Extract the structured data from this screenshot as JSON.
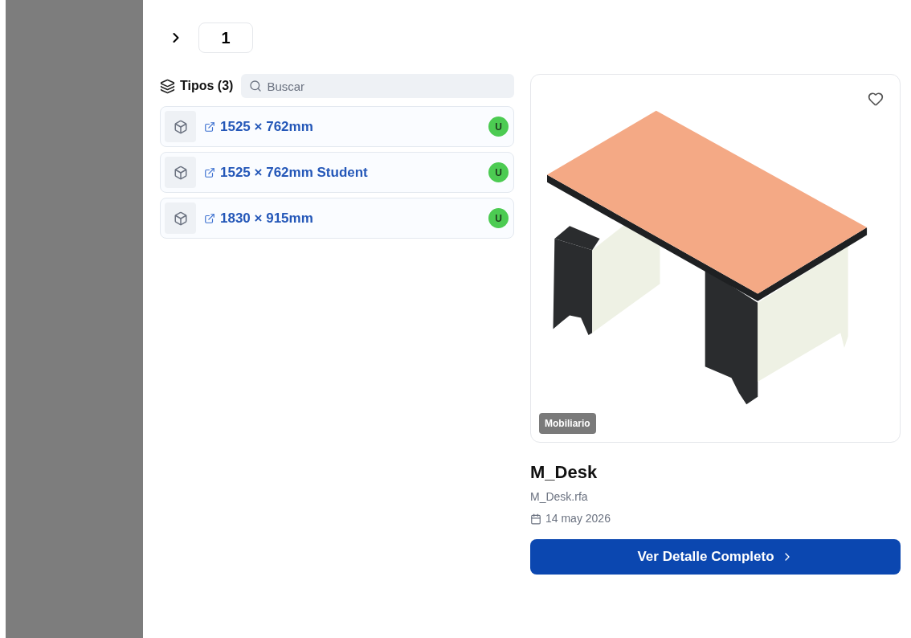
{
  "pager": {
    "page": "1"
  },
  "types": {
    "title": "Tipos (3)",
    "search": {
      "placeholder": "Buscar"
    },
    "items": [
      {
        "label": "1525 × 762mm",
        "badge": "U"
      },
      {
        "label": "1525 × 762mm Student",
        "badge": "U"
      },
      {
        "label": "1830 × 915mm",
        "badge": "U"
      }
    ]
  },
  "preview": {
    "favorite": false,
    "category": "Mobiliario",
    "name": "M_Desk",
    "file": "M_Desk.rfa",
    "date": "14 may 2026",
    "action": "Ver Detalle Completo"
  }
}
